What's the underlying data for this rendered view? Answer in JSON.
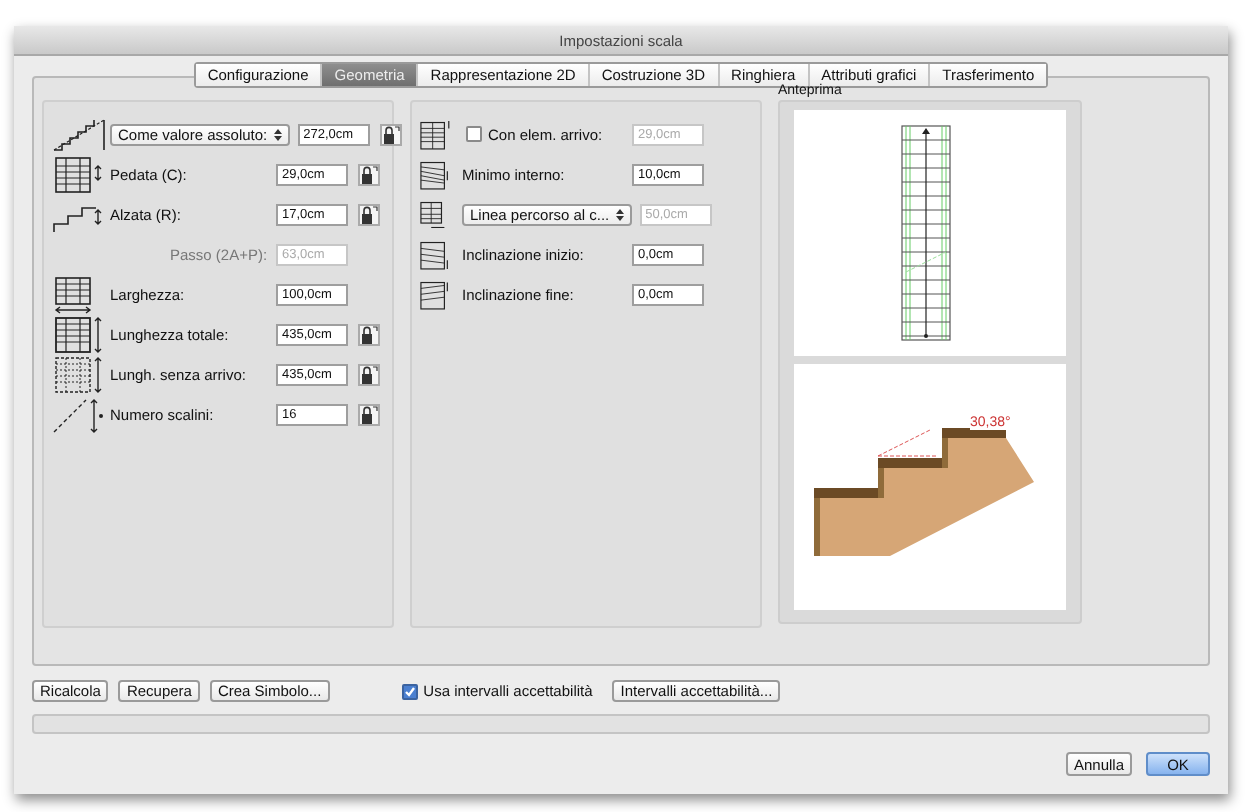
{
  "window": {
    "title": "Impostazioni scala"
  },
  "tabs": [
    {
      "label": "Configurazione",
      "selected": false
    },
    {
      "label": "Geometria",
      "selected": true
    },
    {
      "label": "Rappresentazione 2D",
      "selected": false
    },
    {
      "label": "Costruzione 3D",
      "selected": false
    },
    {
      "label": "Ringhiera",
      "selected": false
    },
    {
      "label": "Attributi grafici",
      "selected": false
    },
    {
      "label": "Trasferimento",
      "selected": false
    }
  ],
  "geometry_rows": [
    {
      "kind": "select",
      "option": "Come valore assoluto:",
      "value": "272,0cm",
      "disabled": false,
      "lock": true
    },
    {
      "kind": "field",
      "label": "Pedata (C):",
      "value": "29,0cm",
      "disabled": false,
      "lock": true
    },
    {
      "kind": "field",
      "label": "Alzata (R):",
      "value": "17,0cm",
      "disabled": false,
      "lock": true
    },
    {
      "kind": "field",
      "label": "Passo (2A+P):",
      "value": "63,0cm",
      "disabled": true,
      "lock": false
    },
    {
      "kind": "field",
      "label": "Larghezza:",
      "value": "100,0cm",
      "disabled": false,
      "lock": false
    },
    {
      "kind": "field",
      "label": "Lunghezza totale:",
      "value": "435,0cm",
      "disabled": false,
      "lock": true
    },
    {
      "kind": "field",
      "label": "Lungh. senza arrivo:",
      "value": "435,0cm",
      "disabled": false,
      "lock": true
    },
    {
      "kind": "field",
      "label": "Numero scalini:",
      "value": "16",
      "disabled": false,
      "lock": true
    }
  ],
  "landing_rows": [
    {
      "kind": "checkbox",
      "label": "Con elem. arrivo:",
      "checked": false,
      "value": "29,0cm",
      "disabled": true
    },
    {
      "kind": "field",
      "label": "Minimo interno:",
      "value": "10,0cm",
      "disabled": false
    },
    {
      "kind": "select",
      "option": "Linea percorso al c...",
      "value": "50,0cm",
      "disabled": true
    },
    {
      "kind": "field",
      "label": "Inclinazione inizio:",
      "value": "0,0cm",
      "disabled": false
    },
    {
      "kind": "field",
      "label": "Inclinazione fine:",
      "value": "0,0cm",
      "disabled": false
    }
  ],
  "preview": {
    "title": "Anteprima",
    "angle": "30,38°"
  },
  "bottom_buttons": [
    "Ricalcola",
    "Recupera",
    "Crea Simbolo..."
  ],
  "acceptance": {
    "label": "Usa intervalli accettabilità",
    "checked": true,
    "button": "Intervalli accettabilità..."
  },
  "dialog_buttons": [
    {
      "label": "Annulla",
      "default": false
    },
    {
      "label": "OK",
      "default": true
    }
  ]
}
